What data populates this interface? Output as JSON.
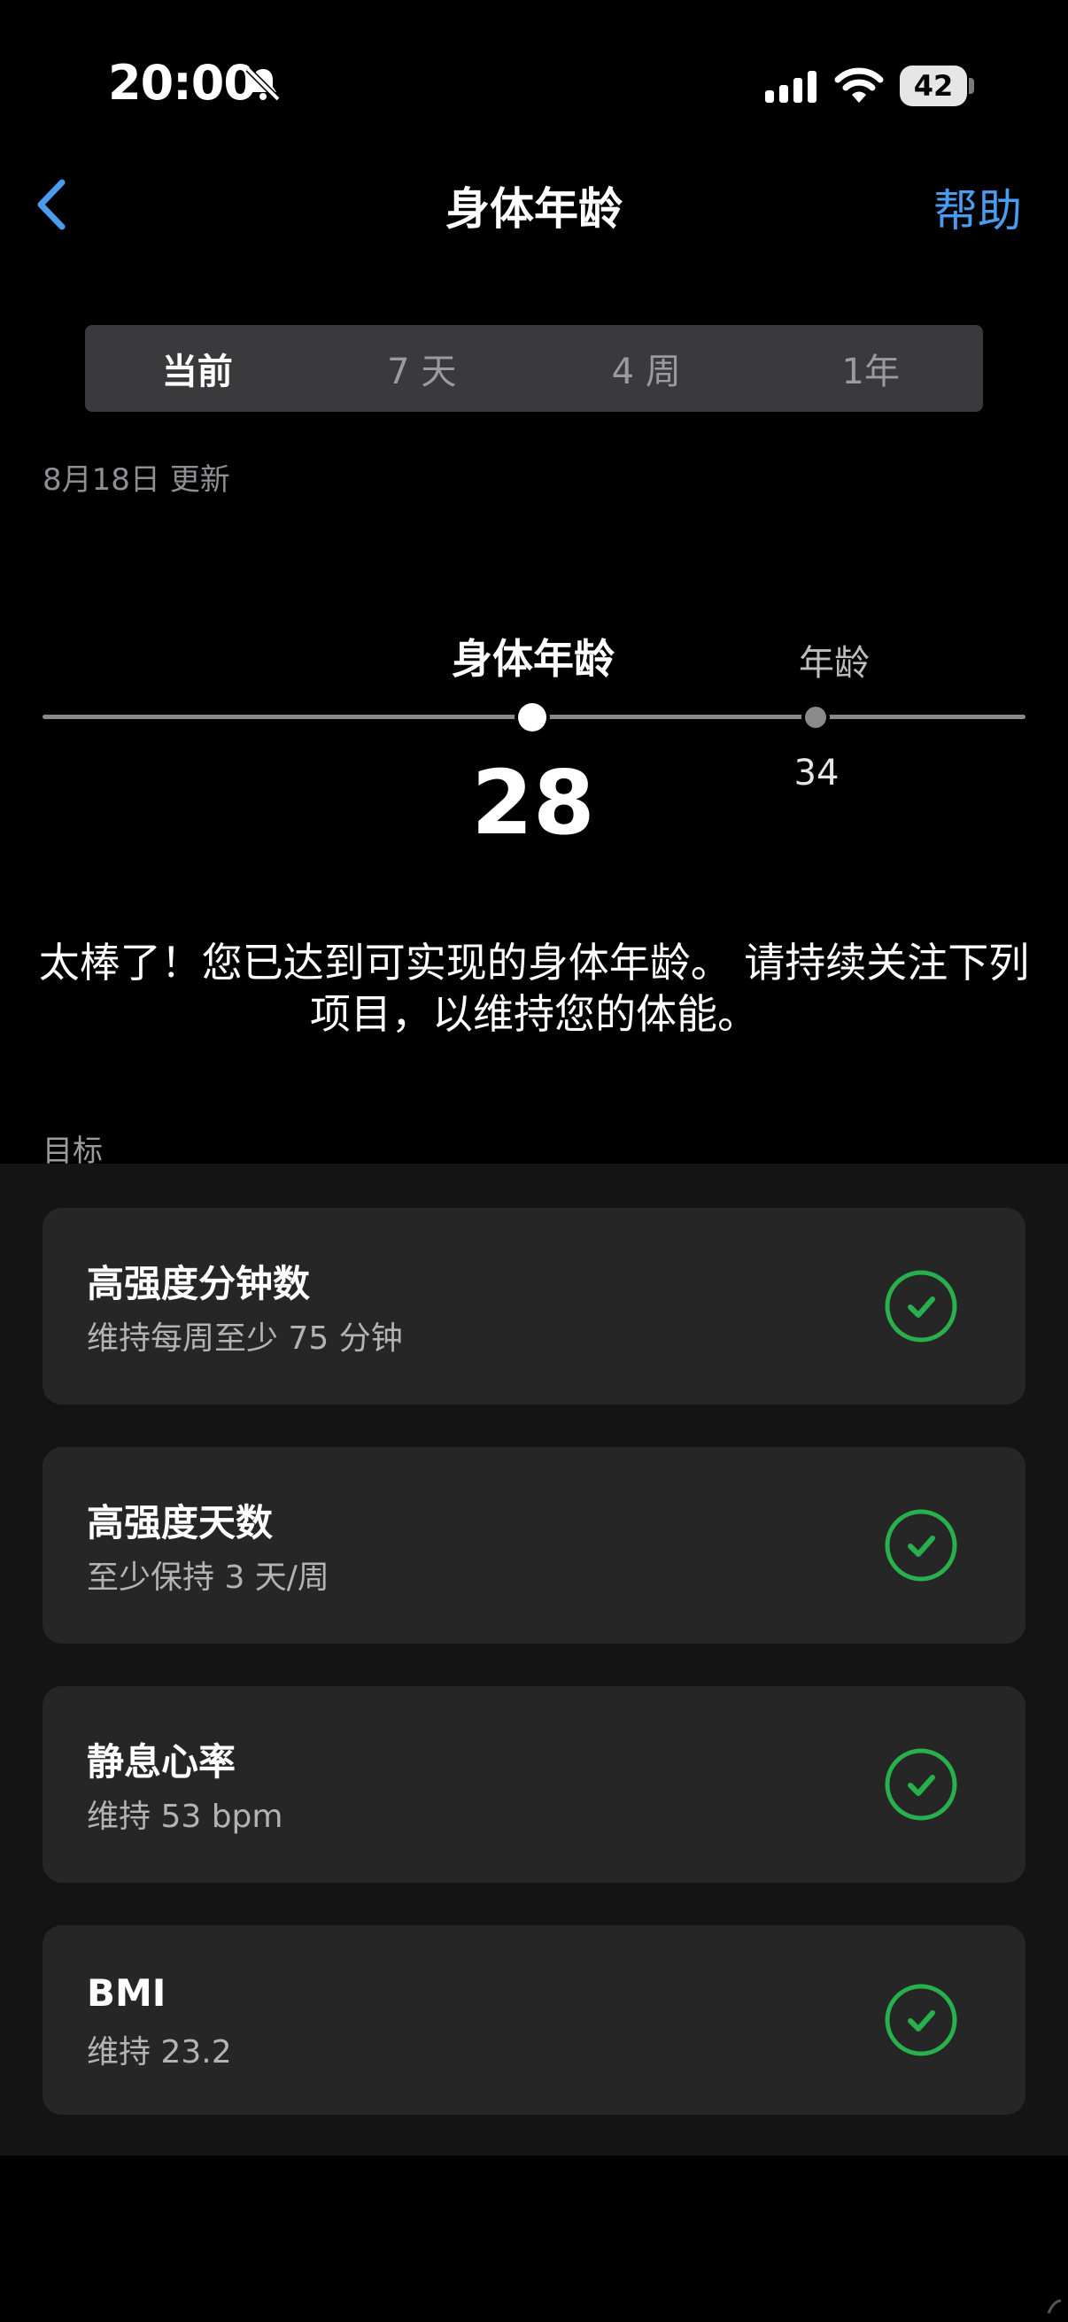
{
  "status_bar": {
    "time": "20:00",
    "battery": "42"
  },
  "nav": {
    "title": "身体年龄",
    "help": "帮助"
  },
  "tabs": [
    {
      "label": "当前",
      "active": true
    },
    {
      "label": "7 天",
      "active": false
    },
    {
      "label": "4 周",
      "active": false
    },
    {
      "label": "1年",
      "active": false
    }
  ],
  "updated": "8月18日 更新",
  "slider": {
    "body_age_label": "身体年龄",
    "body_age_value": "28",
    "age_label": "年龄",
    "age_value": "34"
  },
  "message": "太棒了！您已达到可实现的身体年龄。 请持续关注下列项目，以维持您的体能。",
  "goals_label": "目标",
  "goals": [
    {
      "title": "高强度分钟数",
      "subtitle": "维持每周至少 75 分钟",
      "icon": "check-circle-icon"
    },
    {
      "title": "高强度天数",
      "subtitle": "至少保持 3 天/周",
      "icon": "check-circle-icon"
    },
    {
      "title": "静息心率",
      "subtitle": "维持 53  bpm",
      "icon": "check-circle-icon"
    },
    {
      "title": "BMI",
      "subtitle": "维持 23.2",
      "icon": "check-circle-icon"
    }
  ],
  "colors": {
    "accent": "#4a9cf0",
    "success": "#27b04c",
    "card": "#262626"
  }
}
